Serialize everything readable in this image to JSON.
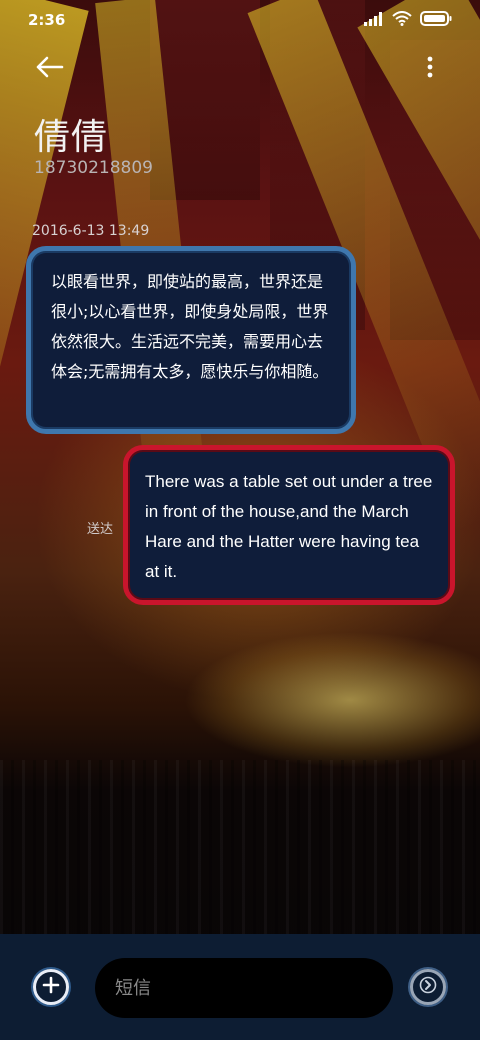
{
  "status_bar": {
    "time": "2:36"
  },
  "header": {
    "contact_name": "倩倩",
    "contact_number": "18730218809",
    "back_icon": "arrow-left-icon",
    "more_icon": "more-vertical-icon"
  },
  "conversation": {
    "timestamp": "2016-6-13 13:49",
    "messages": [
      {
        "direction": "incoming",
        "text": "以眼看世界，即使站的最高，世界还是很小;以心看世界，即使身处局限，世界依然很大。生活远不完美，需要用心去体会;无需拥有太多，愿快乐与你相随。"
      },
      {
        "direction": "outgoing",
        "text": "There was a table set out under a tree in front of the house,and the March Hare and the Hatter were having tea at it.",
        "status": "送达"
      }
    ]
  },
  "composer": {
    "placeholder": "短信",
    "add_icon": "plus-circle-icon",
    "send_icon": "send-chevron-icon"
  },
  "colors": {
    "incoming_border": "#3f77ad",
    "outgoing_border": "#c9152c",
    "bubble_fill": "#0f1d3a",
    "composer_bg": "#0d1d33"
  }
}
